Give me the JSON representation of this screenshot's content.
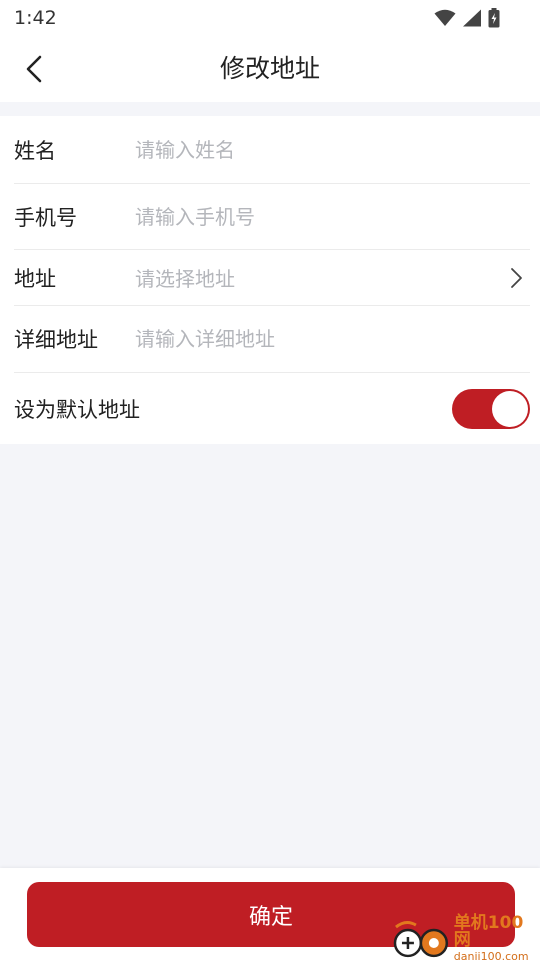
{
  "status_bar": {
    "time": "1:42",
    "icons": [
      "wifi-icon",
      "signal-icon",
      "battery-icon"
    ]
  },
  "header": {
    "title": "修改地址",
    "back_icon": "chevron-left-icon"
  },
  "form": {
    "name": {
      "label": "姓名",
      "placeholder": "请输入姓名",
      "value": ""
    },
    "phone": {
      "label": "手机号",
      "placeholder": "请输入手机号",
      "value": ""
    },
    "address": {
      "label": "地址",
      "placeholder": "请选择地址",
      "icon": "chevron-right-icon"
    },
    "detail": {
      "label": "详细地址",
      "placeholder": "请输入详细地址",
      "value": ""
    },
    "default": {
      "label": "设为默认地址",
      "enabled": true
    }
  },
  "footer": {
    "confirm_label": "确定"
  },
  "watermark": {
    "brand": "单机100网",
    "url": "danji100.com"
  },
  "colors": {
    "accent": "#bf1e24",
    "background": "#f4f5f9",
    "placeholder": "#b4b6bb",
    "divider": "#ebebeb"
  }
}
